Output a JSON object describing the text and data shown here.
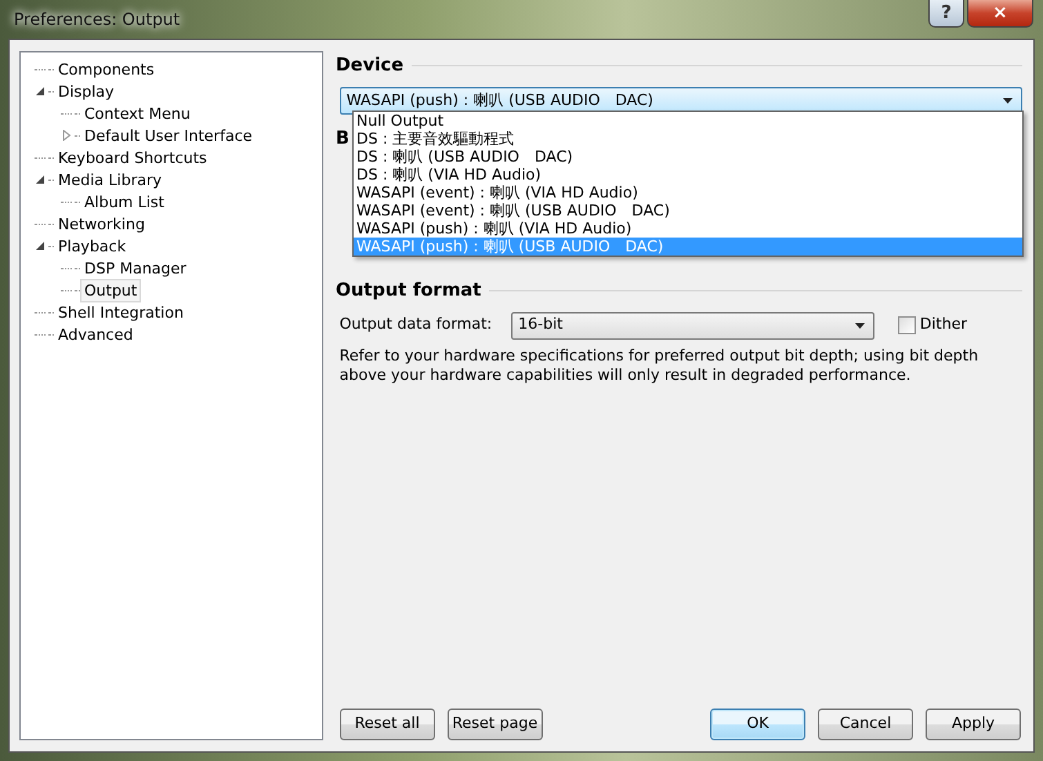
{
  "window": {
    "title": "Preferences: Output",
    "controls": [
      "?",
      "×"
    ]
  },
  "tree": [
    {
      "label": "Components",
      "selected": false
    },
    {
      "label": "Display",
      "selected": false,
      "expanded": true,
      "children": [
        {
          "label": "Context Menu",
          "selected": false
        },
        {
          "label": "Default User Interface",
          "selected": false,
          "expanded": false
        }
      ]
    },
    {
      "label": "Keyboard Shortcuts",
      "selected": false
    },
    {
      "label": "Media Library",
      "selected": false,
      "expanded": true,
      "children": [
        {
          "label": "Album List",
          "selected": false
        }
      ]
    },
    {
      "label": "Networking",
      "selected": false
    },
    {
      "label": "Playback",
      "selected": false,
      "expanded": true,
      "children": [
        {
          "label": "DSP Manager",
          "selected": false
        },
        {
          "label": "Output",
          "selected": true
        }
      ]
    },
    {
      "label": "Shell Integration",
      "selected": false
    },
    {
      "label": "Advanced",
      "selected": false
    }
  ],
  "device": {
    "heading": "Device",
    "value": "WASAPI (push) : 喇叭 (USB AUDIO　DAC)",
    "expanded": true,
    "options": [
      {
        "label": "Null Output",
        "selected": false
      },
      {
        "label": "DS : 主要音效驅動程式",
        "selected": false
      },
      {
        "label": "DS : 喇叭 (USB AUDIO　DAC)",
        "selected": false
      },
      {
        "label": "DS : 喇叭 (VIA HD Audio)",
        "selected": false
      },
      {
        "label": "WASAPI (event) : 喇叭 (VIA HD Audio)",
        "selected": false
      },
      {
        "label": "WASAPI (event) : 喇叭 (USB AUDIO　DAC)",
        "selected": false
      },
      {
        "label": "WASAPI (push) : 喇叭 (VIA HD Audio)",
        "selected": false
      },
      {
        "label": "WASAPI (push) : 喇叭 (USB AUDIO　DAC)",
        "selected": true
      }
    ]
  },
  "hidden_heading": "B",
  "output_format": {
    "heading": "Output format",
    "label": "Output data format:",
    "value": "16-bit",
    "dither": {
      "label": "Dither",
      "checked": false
    },
    "note": "Refer to your hardware specifications for preferred output bit depth; using bit depth above your hardware capabilities will only result in degraded performance."
  },
  "buttons": [
    {
      "label": "Reset all",
      "default": false
    },
    {
      "label": "Reset page",
      "default": false
    },
    {
      "label": "OK",
      "default": true
    },
    {
      "label": "Cancel",
      "default": false
    },
    {
      "label": "Apply",
      "default": false
    }
  ]
}
